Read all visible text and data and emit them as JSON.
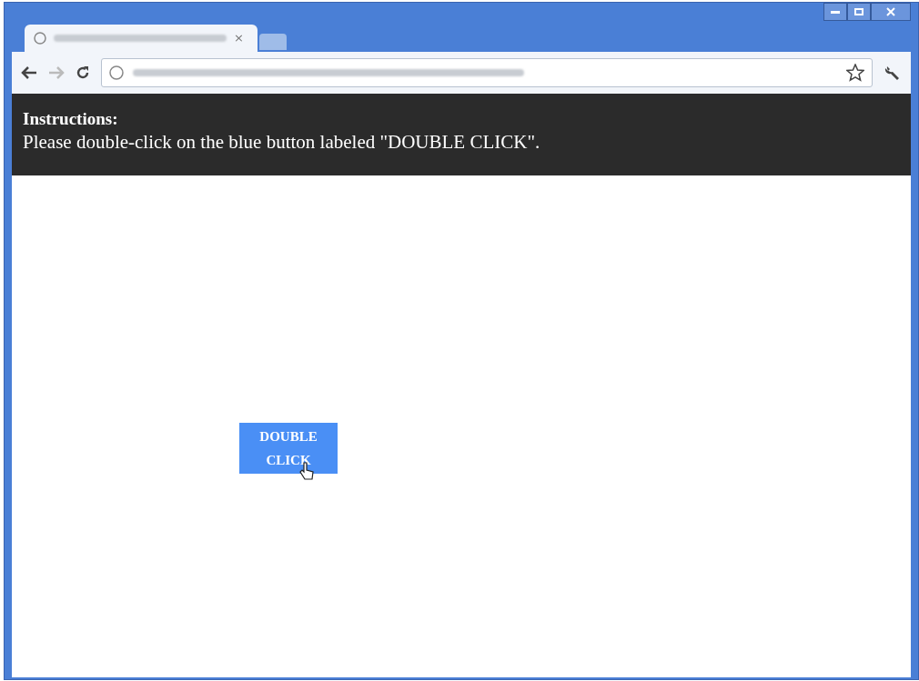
{
  "tab": {
    "close": "×"
  },
  "instructions": {
    "title": "Instructions:",
    "text": "Please double-click on the blue button labeled \"DOUBLE CLICK\"."
  },
  "button": {
    "label": "DOUBLE CLICK"
  }
}
